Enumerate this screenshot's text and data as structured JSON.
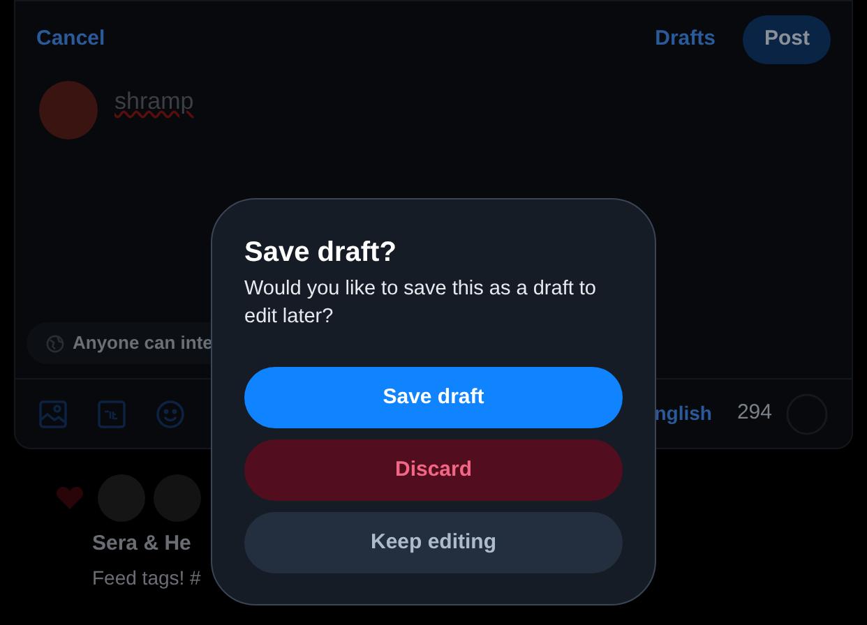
{
  "composer": {
    "cancel": "Cancel",
    "drafts": "Drafts",
    "post": "Post",
    "author": "shramp",
    "audience": "Anyone can inte",
    "language": "nglish",
    "remaining": "294"
  },
  "feed_item": {
    "title": "Sera & He",
    "text": "Feed tags! #"
  },
  "dialog": {
    "title": "Save draft?",
    "message": "Would you like to save this as a draft to edit later?",
    "buttons": [
      {
        "label": "Save draft",
        "kind": "primary"
      },
      {
        "label": "Discard",
        "kind": "danger"
      },
      {
        "label": "Keep editing",
        "kind": "secondary"
      }
    ]
  }
}
